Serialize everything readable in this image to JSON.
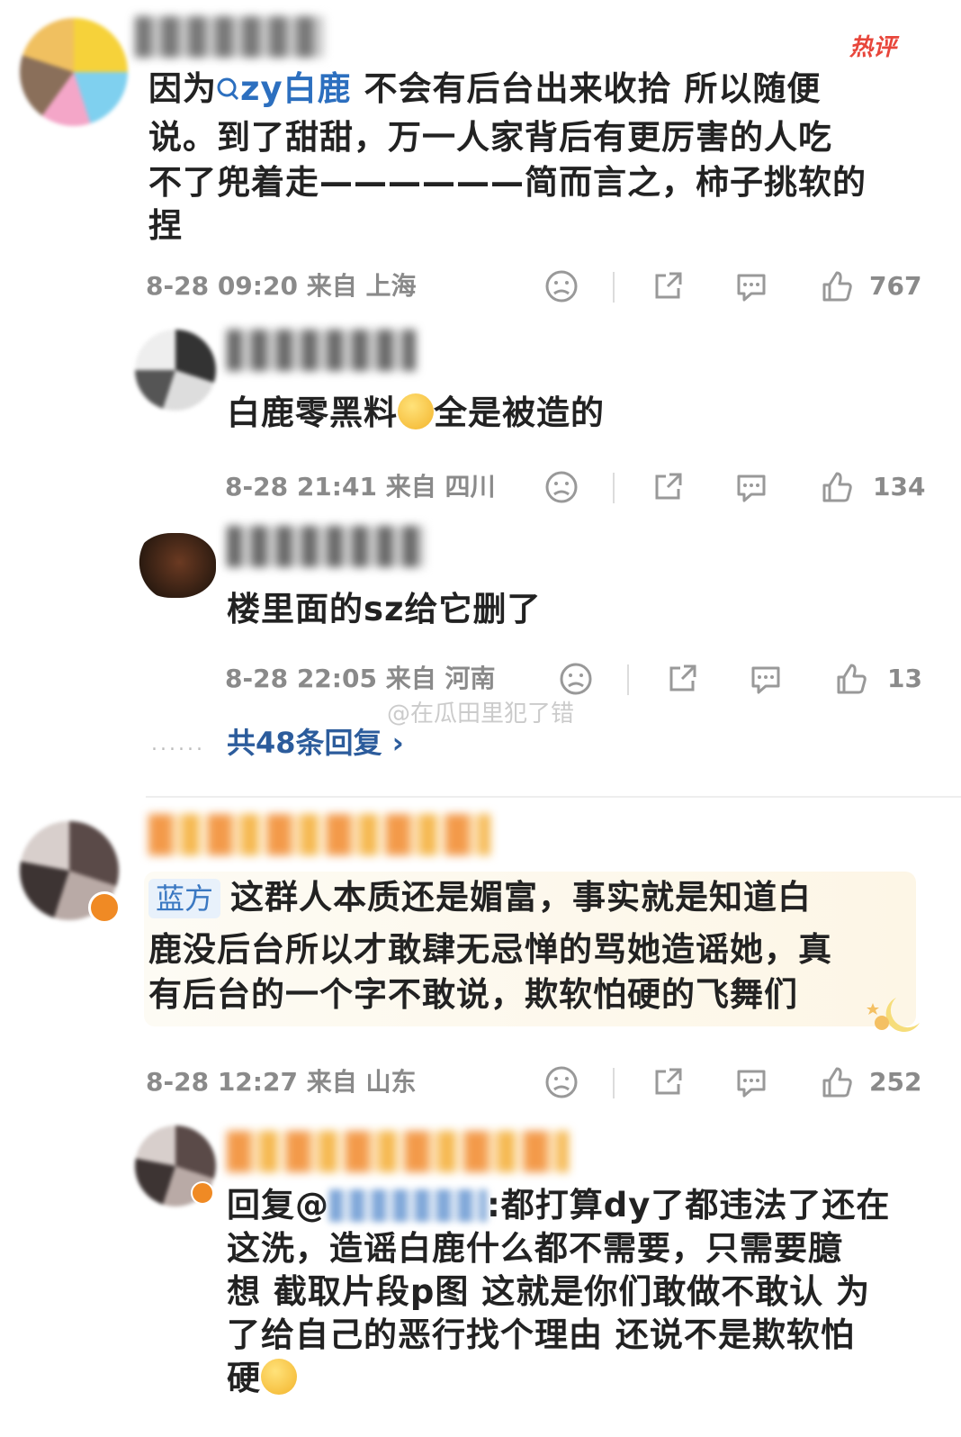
{
  "comments": [
    {
      "badge": "热评",
      "text_lines": [
        "因为",
        "zy白鹿",
        " 不会有后台出来收拾 所以随便",
        "说。到了甜甜，万一人家背后有更厉害的人吃",
        "不了兜着走——————简而言之，柿子挑软的",
        "捏"
      ],
      "meta": "8-28 09:20  来自 上海",
      "likes": "767",
      "replies": [
        {
          "text_a": "白鹿零黑料",
          "text_b": "全是被造的",
          "meta": "8-28 21:41  来自 四川",
          "likes": "134"
        },
        {
          "text": "楼里面的sz给它删了",
          "meta": "8-28 22:05  来自 河南",
          "likes": "13"
        }
      ],
      "more_replies": "共48条回复 ›",
      "dots": "......"
    },
    {
      "tag": "蓝方",
      "text_lines": [
        "这群人本质还是媚富，事实就是知道白",
        "鹿没后台所以才敢肆无忌惮的骂她造谣她，真",
        "有后台的一个字不敢说，欺软怕硬的飞舞们"
      ],
      "meta": "8-28 12:27  来自 山东",
      "likes": "252",
      "reply": {
        "prefix": "回复@",
        "line1_suffix": ":都打算dy了都违法了还在",
        "lines": [
          "这洗，造谣白鹿什么都不需要，只需要臆",
          "想 截取片段p图 这就是你们敢做不敢认 为",
          "了给自己的恶行找个理由 还说不是欺软怕"
        ],
        "last": "硬"
      }
    }
  ],
  "watermark": "@在瓜田里犯了错",
  "icons": [
    "search-icon",
    "dislike-face-icon",
    "share-icon",
    "comment-icon",
    "like-thumb-icon",
    "verified-badge-icon",
    "chevron-right-icon"
  ],
  "colors": {
    "mention": "#2c6fbf",
    "meta": "#8a8a8a",
    "hot": "#e8463b",
    "verified": "#f08a24"
  }
}
